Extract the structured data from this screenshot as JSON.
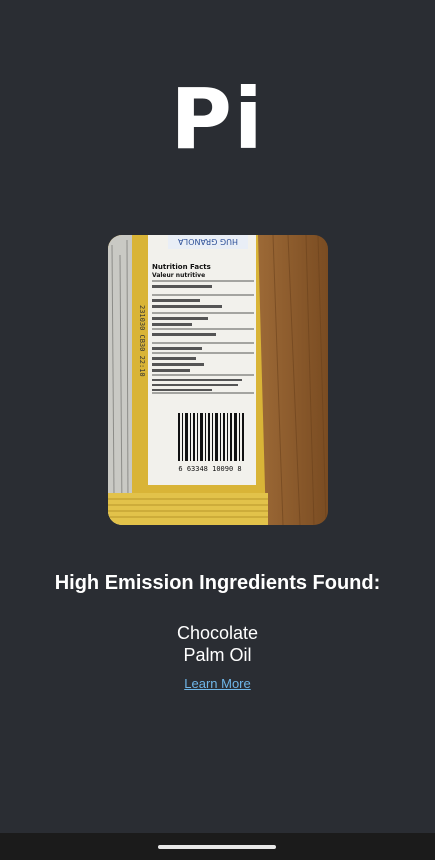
{
  "app": {
    "title": "Pi"
  },
  "photo": {
    "label_header": "Nutrition Facts",
    "label_subheader": "Valeur nutritive",
    "barcode_digits": "6 63348 10090 8"
  },
  "results": {
    "heading": "High Emission Ingredients Found:",
    "ingredients": [
      "Chocolate",
      "Palm Oil"
    ],
    "learn_more": "Learn More"
  },
  "colors": {
    "background": "#2a2d33",
    "link": "#6fb6e8",
    "wrapper_yellow": "#d9b437"
  }
}
